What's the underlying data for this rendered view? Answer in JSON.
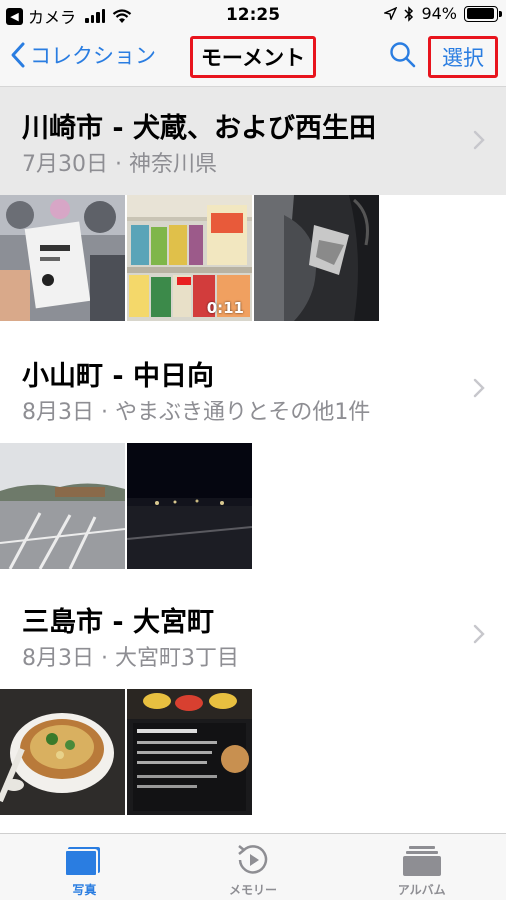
{
  "status_bar": {
    "back_glyph": "◀",
    "carrier": "カメラ",
    "time": "12:25",
    "battery_percent": "94%",
    "battery_level": 0.94
  },
  "nav": {
    "back_label": "コレクション",
    "title": "モーメント",
    "select_label": "選択",
    "highlight_color": "#e8141d",
    "accent_color": "#2a7de1"
  },
  "moments": [
    {
      "title": "川崎市 - 犬蔵、および西生田",
      "subtitle": "7月30日 · 神奈川県",
      "video_duration": "0:11"
    },
    {
      "title": "小山町 - 中日向",
      "subtitle": "8月3日 · やまぶき通りとその他1件"
    },
    {
      "title": "三島市 - 大宮町",
      "subtitle": "8月3日 · 大宮町3丁目"
    }
  ],
  "tabs": [
    {
      "label": "写真",
      "icon": "photos-icon",
      "active": true
    },
    {
      "label": "メモリー",
      "icon": "memories-icon",
      "active": false
    },
    {
      "label": "アルバム",
      "icon": "albums-icon",
      "active": false
    }
  ]
}
